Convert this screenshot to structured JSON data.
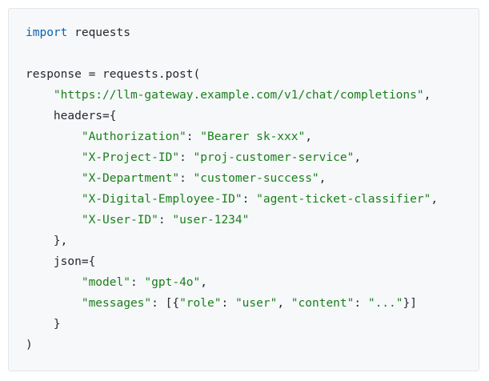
{
  "code": {
    "lines": [
      [
        {
          "t": "kw",
          "v": "import"
        },
        {
          "t": "plain",
          "v": " requests"
        }
      ],
      [],
      [
        {
          "t": "plain",
          "v": "response = requests.post("
        }
      ],
      [
        {
          "t": "plain",
          "v": "    "
        },
        {
          "t": "str",
          "v": "\"https://llm-gateway.example.com/v1/chat/completions\""
        },
        {
          "t": "plain",
          "v": ","
        }
      ],
      [
        {
          "t": "plain",
          "v": "    headers={"
        }
      ],
      [
        {
          "t": "plain",
          "v": "        "
        },
        {
          "t": "str",
          "v": "\"Authorization\""
        },
        {
          "t": "plain",
          "v": ": "
        },
        {
          "t": "str",
          "v": "\"Bearer sk-xxx\""
        },
        {
          "t": "plain",
          "v": ","
        }
      ],
      [
        {
          "t": "plain",
          "v": "        "
        },
        {
          "t": "str",
          "v": "\"X-Project-ID\""
        },
        {
          "t": "plain",
          "v": ": "
        },
        {
          "t": "str",
          "v": "\"proj-customer-service\""
        },
        {
          "t": "plain",
          "v": ","
        }
      ],
      [
        {
          "t": "plain",
          "v": "        "
        },
        {
          "t": "str",
          "v": "\"X-Department\""
        },
        {
          "t": "plain",
          "v": ": "
        },
        {
          "t": "str",
          "v": "\"customer-success\""
        },
        {
          "t": "plain",
          "v": ","
        }
      ],
      [
        {
          "t": "plain",
          "v": "        "
        },
        {
          "t": "str",
          "v": "\"X-Digital-Employee-ID\""
        },
        {
          "t": "plain",
          "v": ": "
        },
        {
          "t": "str",
          "v": "\"agent-ticket-classifier\""
        },
        {
          "t": "plain",
          "v": ","
        }
      ],
      [
        {
          "t": "plain",
          "v": "        "
        },
        {
          "t": "str",
          "v": "\"X-User-ID\""
        },
        {
          "t": "plain",
          "v": ": "
        },
        {
          "t": "str",
          "v": "\"user-1234\""
        }
      ],
      [
        {
          "t": "plain",
          "v": "    },"
        }
      ],
      [
        {
          "t": "plain",
          "v": "    json={"
        }
      ],
      [
        {
          "t": "plain",
          "v": "        "
        },
        {
          "t": "str",
          "v": "\"model\""
        },
        {
          "t": "plain",
          "v": ": "
        },
        {
          "t": "str",
          "v": "\"gpt-4o\""
        },
        {
          "t": "plain",
          "v": ","
        }
      ],
      [
        {
          "t": "plain",
          "v": "        "
        },
        {
          "t": "str",
          "v": "\"messages\""
        },
        {
          "t": "plain",
          "v": ": [{"
        },
        {
          "t": "str",
          "v": "\"role\""
        },
        {
          "t": "plain",
          "v": ": "
        },
        {
          "t": "str",
          "v": "\"user\""
        },
        {
          "t": "plain",
          "v": ", "
        },
        {
          "t": "str",
          "v": "\"content\""
        },
        {
          "t": "plain",
          "v": ": "
        },
        {
          "t": "str",
          "v": "\"...\""
        },
        {
          "t": "plain",
          "v": "}]"
        }
      ],
      [
        {
          "t": "plain",
          "v": "    }"
        }
      ],
      [
        {
          "t": "plain",
          "v": ")"
        }
      ]
    ]
  },
  "colors": {
    "keyword": "#0b63b6",
    "string": "#1a7f1a",
    "text": "#24292f",
    "panel_background": "#f6f8fa"
  }
}
